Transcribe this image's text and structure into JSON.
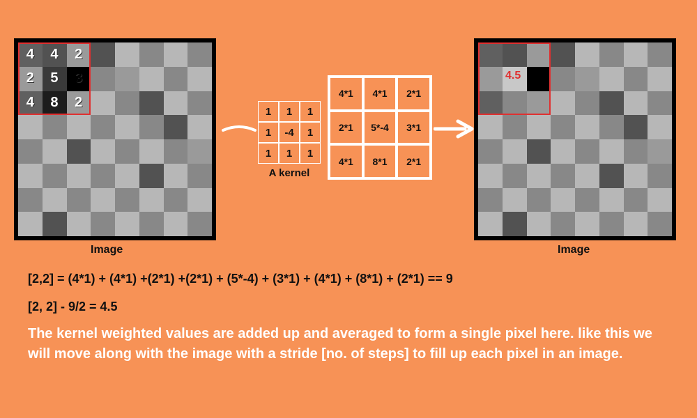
{
  "input_grid_shades": [
    "#606060",
    "#525252",
    "#9a9a9a",
    "#525252",
    "#b7b7b7",
    "#888888",
    "#b7b7b7",
    "#888888",
    "#9a9a9a",
    "#3a3a3a",
    "#000000",
    "#888888",
    "#9a9a9a",
    "#b7b7b7",
    "#888888",
    "#b7b7b7",
    "#606060",
    "#1c1c1c",
    "#9a9a9a",
    "#b7b7b7",
    "#888888",
    "#525252",
    "#b7b7b7",
    "#888888",
    "#b7b7b7",
    "#888888",
    "#b7b7b7",
    "#888888",
    "#b7b7b7",
    "#888888",
    "#525252",
    "#b7b7b7",
    "#888888",
    "#b7b7b7",
    "#525252",
    "#b7b7b7",
    "#888888",
    "#b7b7b7",
    "#888888",
    "#9a9a9a",
    "#b7b7b7",
    "#888888",
    "#b7b7b7",
    "#888888",
    "#b7b7b7",
    "#525252",
    "#b7b7b7",
    "#888888",
    "#888888",
    "#b7b7b7",
    "#888888",
    "#b7b7b7",
    "#888888",
    "#b7b7b7",
    "#888888",
    "#b7b7b7",
    "#b7b7b7",
    "#525252",
    "#b7b7b7",
    "#888888",
    "#b7b7b7",
    "#888888",
    "#b7b7b7",
    "#888888"
  ],
  "output_grid_shades": [
    "#606060",
    "#525252",
    "#9a9a9a",
    "#525252",
    "#b7b7b7",
    "#888888",
    "#b7b7b7",
    "#888888",
    "#9a9a9a",
    "#c8c8c8",
    "#000000",
    "#888888",
    "#9a9a9a",
    "#b7b7b7",
    "#888888",
    "#b7b7b7",
    "#606060",
    "#888888",
    "#9a9a9a",
    "#b7b7b7",
    "#888888",
    "#525252",
    "#b7b7b7",
    "#888888",
    "#b7b7b7",
    "#888888",
    "#b7b7b7",
    "#888888",
    "#b7b7b7",
    "#888888",
    "#525252",
    "#b7b7b7",
    "#888888",
    "#b7b7b7",
    "#525252",
    "#b7b7b7",
    "#888888",
    "#b7b7b7",
    "#888888",
    "#9a9a9a",
    "#b7b7b7",
    "#888888",
    "#b7b7b7",
    "#888888",
    "#b7b7b7",
    "#525252",
    "#b7b7b7",
    "#888888",
    "#888888",
    "#b7b7b7",
    "#888888",
    "#b7b7b7",
    "#888888",
    "#b7b7b7",
    "#888888",
    "#b7b7b7",
    "#b7b7b7",
    "#525252",
    "#b7b7b7",
    "#888888",
    "#b7b7b7",
    "#888888",
    "#b7b7b7",
    "#888888"
  ],
  "overlay_numbers": [
    "4",
    "4",
    "2",
    "2",
    "5",
    "3",
    "4",
    "8",
    "2"
  ],
  "kernel_values": [
    "1",
    "1",
    "1",
    "1",
    "-4",
    "1",
    "1",
    "1",
    "1"
  ],
  "kernel_label": "A kernel",
  "product_values": [
    "4*1",
    "4*1",
    "2*1",
    "2*1",
    "5*-4",
    "3*1",
    "4*1",
    "8*1",
    "2*1"
  ],
  "image_label": "Image",
  "result_value": "4.5",
  "equation1": "[2,2] = (4*1) + (4*1) +(2*1) +(2*1) + (5*-4) + (3*1) + (4*1) + (8*1) + (2*1) == 9",
  "equation2": "[2, 2] - 9/2 = 4.5",
  "description": "The kernel weighted values are added up and averaged to form a single pixel here. like this we will move along with the image with a stride [no. of steps] to fill up each pixel in an image."
}
